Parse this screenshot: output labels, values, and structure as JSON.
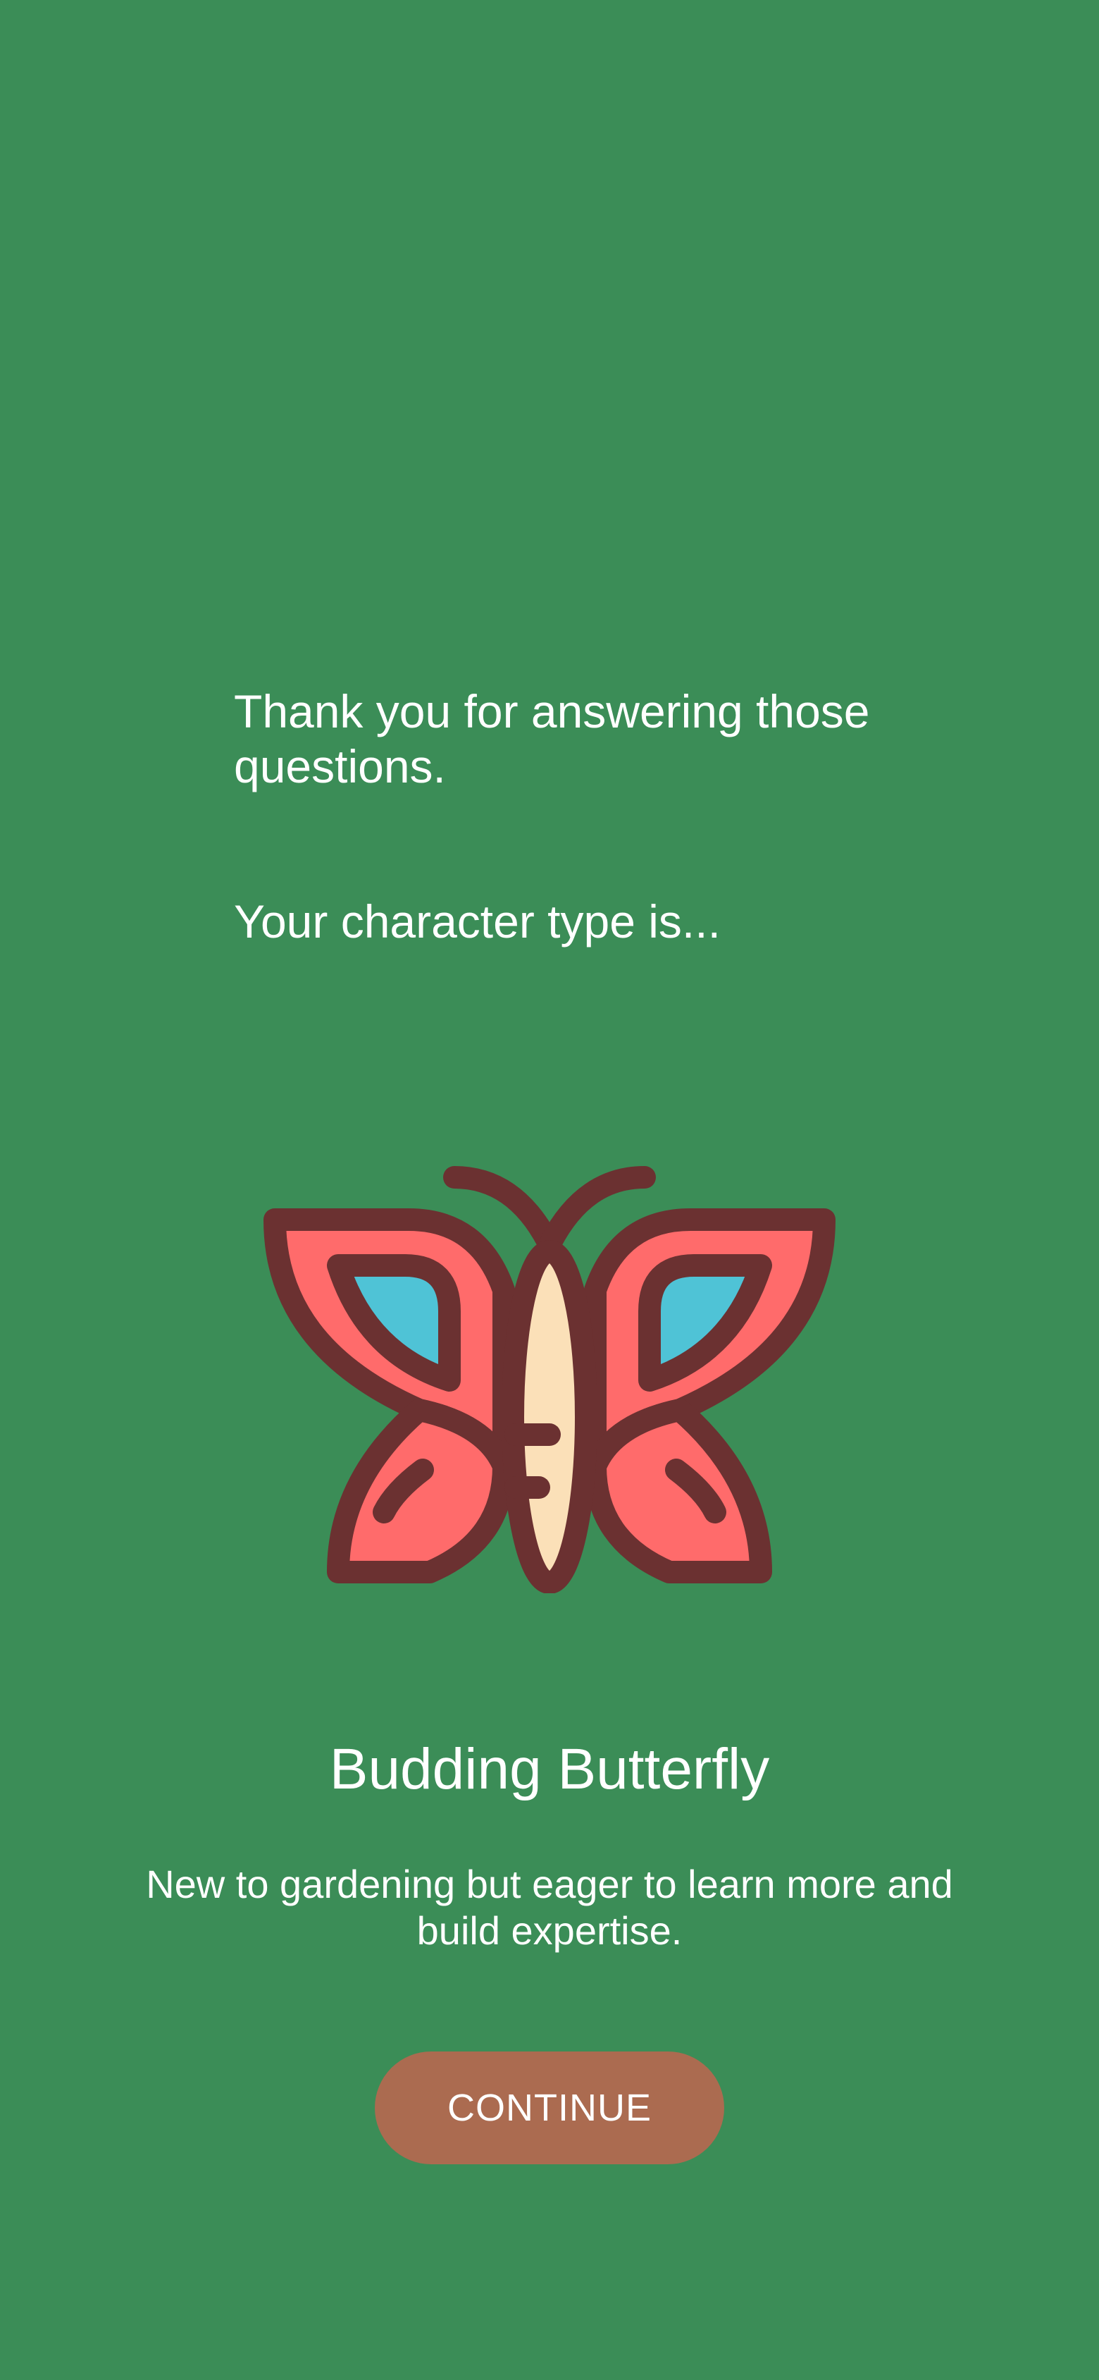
{
  "intro": {
    "thanks_text": "Thank you for answering those questions.",
    "reveal_text": "Your character type is..."
  },
  "result": {
    "character_name": "Budding Butterfly",
    "description": "New to gardening but eager to learn more and build expertise.",
    "illustration_icon": "butterfly-icon"
  },
  "actions": {
    "continue_label": "CONTINUE"
  },
  "colors": {
    "background": "#3b8d57",
    "button": "#ab6b50",
    "wing": "#ff6b6b",
    "wing_spot": "#4fc3d6",
    "body": "#fbe0b8",
    "outline": "#6b3131"
  }
}
